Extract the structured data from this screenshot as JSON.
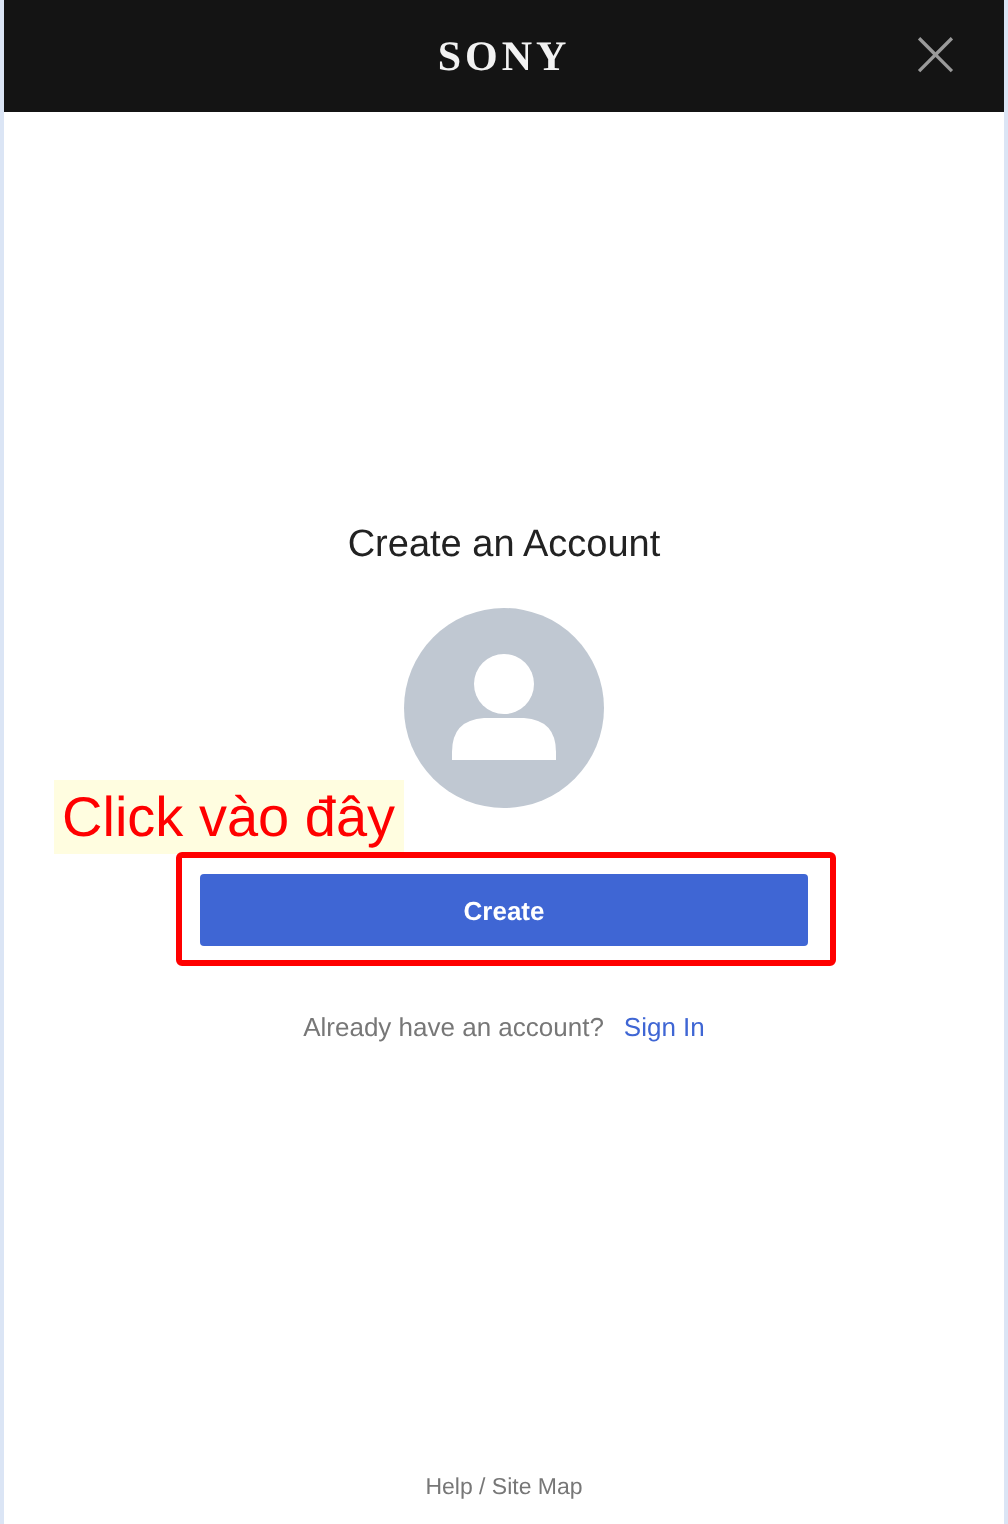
{
  "header": {
    "logo": "SONY",
    "close": "×"
  },
  "title": "Create an Account",
  "annotation": {
    "label": "Click vào đây"
  },
  "create_button": "Create",
  "signin_prompt": {
    "text": "Already have an account?",
    "link": "Sign In"
  },
  "footer": {
    "link": "Help / Site Map"
  }
}
